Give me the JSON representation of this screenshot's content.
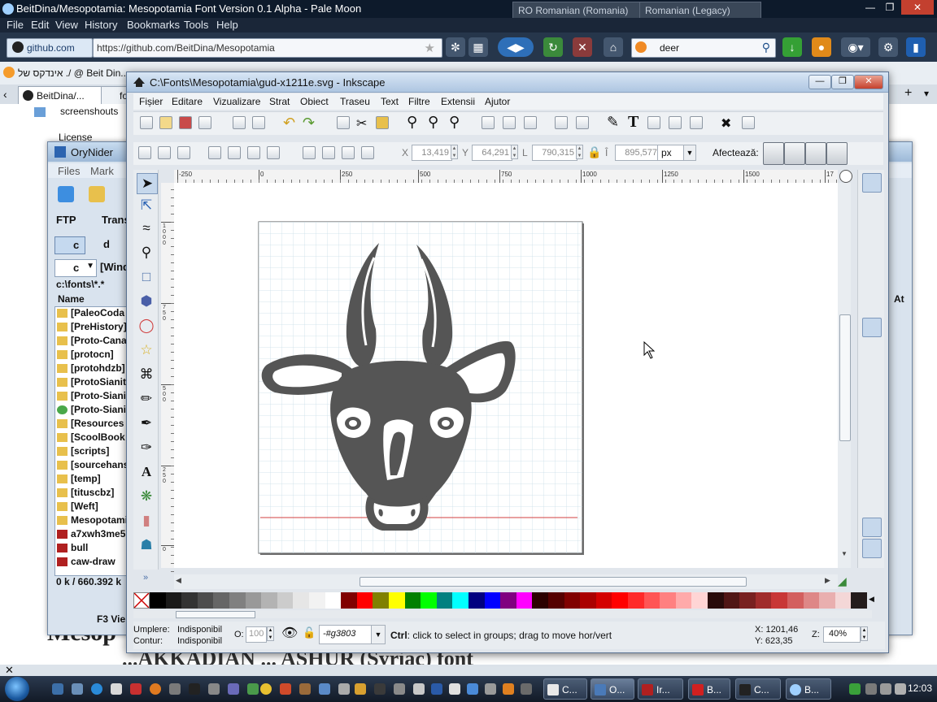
{
  "browser": {
    "title": "BeitDina/Mesopotamia: Mesopotamia Font Version 0.1 Alpha - Pale Moon",
    "language_1": "RO Romanian (Romania)",
    "language_2": "Romanian (Legacy)",
    "menu": [
      "File",
      "Edit",
      "View",
      "History",
      "Bookmarks",
      "Tools",
      "Help"
    ],
    "site_badge": "github.com",
    "url": "https://github.com/BeitDina/Mesopotamia",
    "search": "deer",
    "bookmark_1": "אינדקס של ./ @ Beit Din...",
    "tab_1": "BeitDina/...",
    "tab_2": "fo",
    "page_rows": [
      "screenshouts",
      "License"
    ],
    "page_heading": "Mesop",
    "page_line2": "...AKKADIAN ... ASHUR (Syriac) font"
  },
  "orynider": {
    "title": "OryNider",
    "menu": [
      "Files",
      "Mark"
    ],
    "ftp": "FTP",
    "trans": "Trans",
    "drive_c": "c",
    "drive_d": "d",
    "drive_select": "c",
    "windows": "[Wind",
    "path": "c:\\fonts\\*.*",
    "column_name": "Name",
    "files": [
      "[PaleoCoda",
      "[PreHistory]",
      "[Proto-Cana",
      "[protocn]",
      "[protohdzb]",
      "[ProtoSianit",
      "[Proto-Siani",
      "[Proto-Siani",
      "[Resources",
      "[ScoolBook",
      "[scripts]",
      "[sourcehans",
      "[temp]",
      "[tituscbz]",
      "[Weft]",
      "Mesopotami",
      "a7xwh3me5",
      "bull",
      "caw-draw"
    ],
    "status": "0 k / 660.392 k",
    "fkey": "F3 Vie",
    "at": "At"
  },
  "inkscape": {
    "title": "C:\\Fonts\\Mesopotamia\\gud-x1211e.svg - Inkscape",
    "menu": [
      "Fișier",
      "Editare",
      "Vizualizare",
      "Strat",
      "Obiect",
      "Traseu",
      "Text",
      "Filtre",
      "Extensii",
      "Ajutor"
    ],
    "x_label": "X",
    "x_value": "13,419",
    "y_label": "Y",
    "y_value": "64,291",
    "w_label": "L",
    "w_value": "790,315",
    "h_label": "Î",
    "h_value": "895,577",
    "unit": "px",
    "afecteaza": "Afectează:",
    "ruler_top": [
      "-250",
      "0",
      "250",
      "500",
      "750",
      "1000",
      "1250",
      "1500",
      "17"
    ],
    "ruler_left": [
      "1000",
      "750",
      "500",
      "250",
      "0"
    ],
    "fill_label": "Umplere:",
    "fill_value": "Indisponibil",
    "stroke_label": "Contur:",
    "stroke_value": "Indisponibil",
    "opacity_label": "O:",
    "opacity_value": "100",
    "layer": "-#g3803",
    "status_bold": "Ctrl",
    "status_text": ": click to select in groups; drag to move hor/vert",
    "coord_x": "X: 1201,46",
    "coord_y": "Y:  623,35",
    "zoom_label": "Z:",
    "zoom_value": "40%",
    "palette": [
      "#000000",
      "#1a1a1a",
      "#333333",
      "#4d4d4d",
      "#666666",
      "#808080",
      "#999999",
      "#b3b3b3",
      "#cccccc",
      "#e6e6e6",
      "#f2f2f2",
      "#ffffff",
      "#800000",
      "#ff0000",
      "#808000",
      "#ffff00",
      "#008000",
      "#00ff00",
      "#008080",
      "#00ffff",
      "#000080",
      "#0000ff",
      "#800080",
      "#ff00ff",
      "#2b0000",
      "#550000",
      "#800000",
      "#aa0000",
      "#d40000",
      "#ff0000",
      "#ff2a2a",
      "#ff5555",
      "#ff8080",
      "#ffaaaa",
      "#ffd5d5",
      "#280b0b",
      "#501616",
      "#782121",
      "#a02c2c",
      "#c83737",
      "#d35f5f",
      "#de8787",
      "#e9afaf",
      "#f4d7d7",
      "#241c1c"
    ]
  },
  "taskbar": {
    "tasks": [
      "C...",
      "O...",
      "Ir...",
      "B...",
      "C...",
      "B..."
    ],
    "clock": "12:03"
  }
}
